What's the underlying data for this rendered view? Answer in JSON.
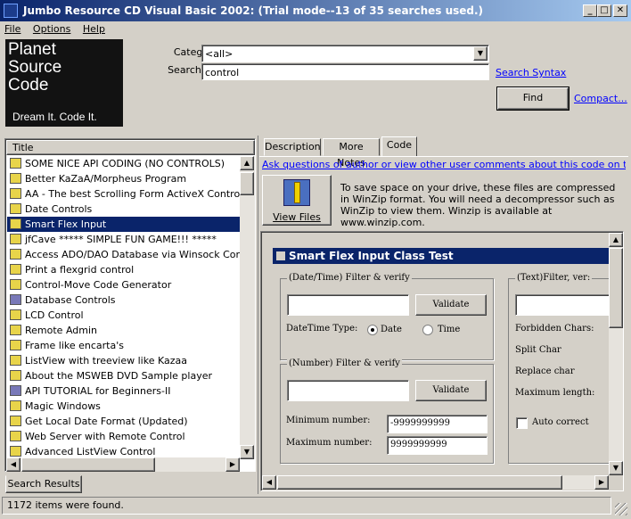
{
  "window": {
    "title": "Jumbo Resource CD Visual Basic 2002: (Trial mode--13 of 35 searches used.)"
  },
  "menu": [
    "File",
    "Options",
    "Help"
  ],
  "logo": {
    "line1": "Planet",
    "line2": "Source",
    "line3": "Code",
    "tagline": "Dream It.  Code It."
  },
  "search": {
    "category_label": "Category:",
    "category_value": "<all>",
    "searchfor_label": "Search for:",
    "searchfor_value": "control",
    "syntax_link": "Search Syntax",
    "find_button": "Find",
    "compact_link": "Compact..."
  },
  "results": {
    "column_title": "Title",
    "items": [
      {
        "label": "SOME NICE API CODING (NO CONTROLS)",
        "icon": "vb-module-icon"
      },
      {
        "label": "Better KaZaA/Morpheus Program",
        "icon": "vb-module-icon"
      },
      {
        "label": "AA - The best Scrolling Form ActiveX Control on PS",
        "icon": "vb-module-icon"
      },
      {
        "label": "Date Controls",
        "icon": "vb-module-icon"
      },
      {
        "label": "Smart Flex Input",
        "icon": "vb-module-icon",
        "selected": true
      },
      {
        "label": "jfCave  *****  SIMPLE FUN GAME!!!  *****",
        "icon": "vb-module-icon"
      },
      {
        "label": "Access ADO/DAO Database via Winsock Control",
        "icon": "vb-module-icon"
      },
      {
        "label": "Print a flexgrid control",
        "icon": "vb-module-icon"
      },
      {
        "label": "Control-Move Code Generator",
        "icon": "vb-module-icon"
      },
      {
        "label": "Database Controls",
        "icon": "vb-project-icon"
      },
      {
        "label": "LCD Control",
        "icon": "vb-module-icon"
      },
      {
        "label": "Remote Admin",
        "icon": "vb-module-icon"
      },
      {
        "label": "Frame like encarta's",
        "icon": "vb-module-icon"
      },
      {
        "label": "ListView with treeview like Kazaa",
        "icon": "vb-module-icon"
      },
      {
        "label": "About the MSWEB DVD Sample player",
        "icon": "vb-module-icon"
      },
      {
        "label": "API TUTORIAL for Beginners-II",
        "icon": "vb-project-icon"
      },
      {
        "label": "Magic Windows",
        "icon": "vb-module-icon"
      },
      {
        "label": "Get Local Date Format (Updated)",
        "icon": "vb-module-icon"
      },
      {
        "label": "Web Server with Remote Control",
        "icon": "vb-module-icon"
      },
      {
        "label": "Advanced ListView Control",
        "icon": "vb-module-icon"
      }
    ],
    "bottom_tab": "Search Results"
  },
  "detail": {
    "tabs": [
      "Description",
      "More Notes",
      "Code"
    ],
    "active_tab": "Code",
    "ask_link": "Ask questions of author or view other user comments about this code on the web...",
    "view_files_button": "View Files",
    "note": "To save space on your drive, these files are compressed in WinZip format.  You will need a decompressor such as WinZip to view them.  Winzip is available at www.winzip.com."
  },
  "preview": {
    "title": "Smart Flex Input Class Test",
    "datetime_group": "(Date/Time) Filter & verify",
    "validate1": "Validate",
    "datetime_type_label": "DateTime Type:",
    "radio_date": "Date",
    "radio_time": "Time",
    "number_group": "(Number) Filter & verify",
    "validate2": "Validate",
    "min_label": "Minimum number:",
    "min_value": "-9999999999",
    "max_label": "Maximum number:",
    "max_value": "9999999999",
    "text_group": "(Text)Filter, ver:",
    "forbidden": "Forbidden Chars:",
    "split": "Split Char",
    "replace": "Replace char",
    "maxlen": "Maximum length:",
    "autocorrect": "Auto correct"
  },
  "status": {
    "text": "1172 items were found."
  }
}
